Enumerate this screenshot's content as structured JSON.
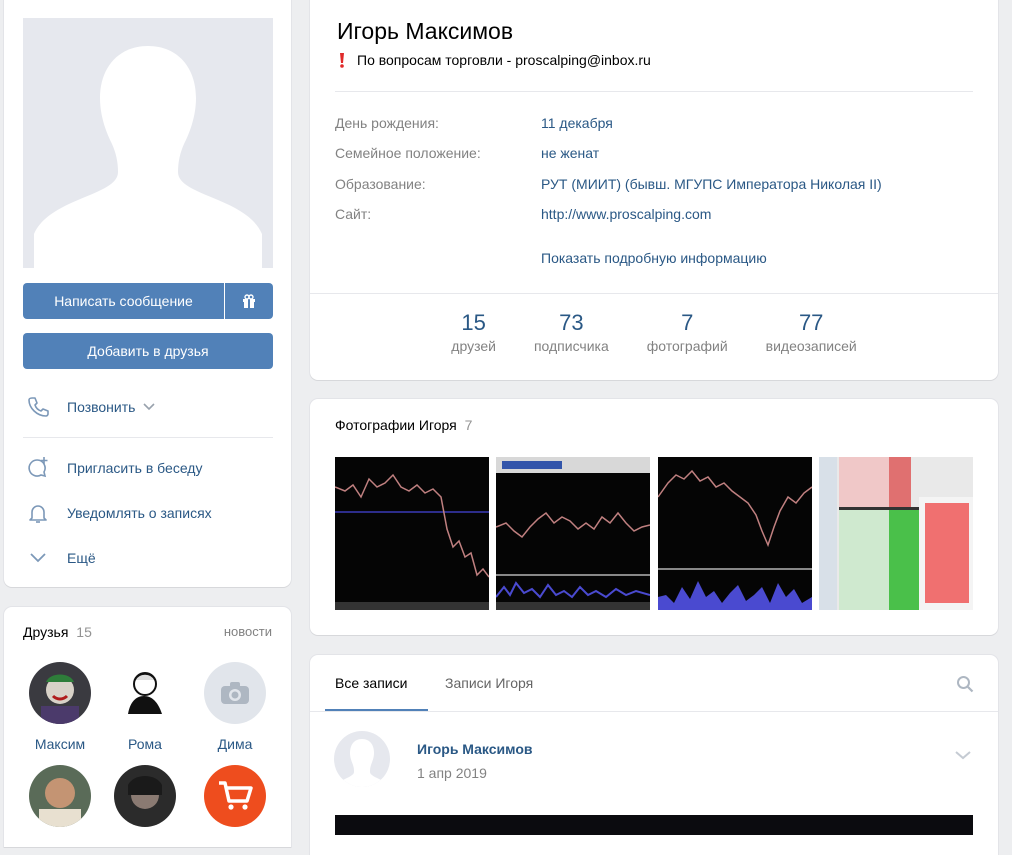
{
  "profile": {
    "name": "Игорь Максимов",
    "status": "По вопросам торговли - proscalping@inbox.ru",
    "info_rows": [
      {
        "key": "День рождения:",
        "value": "11 декабря"
      },
      {
        "key": "Семейное положение:",
        "value": "не женат"
      },
      {
        "key": "Образование:",
        "value": "РУТ (МИИТ) (бывш. МГУПС Императора Николая II)"
      },
      {
        "key": "Сайт:",
        "value": "http://www.proscalping.com"
      }
    ],
    "show_more": "Показать подробную информацию",
    "counters": [
      {
        "num": "15",
        "label": "друзей"
      },
      {
        "num": "73",
        "label": "подписчика"
      },
      {
        "num": "7",
        "label": "фотографий"
      },
      {
        "num": "77",
        "label": "видеозаписей"
      }
    ]
  },
  "sidebar": {
    "message_button": "Написать сообщение",
    "add_friend_button": "Добавить в друзья",
    "call": "Позвонить",
    "invite": "Пригласить в беседу",
    "notify": "Уведомлять о записях",
    "more": "Ещё"
  },
  "friends": {
    "title": "Друзья",
    "count": "15",
    "news_link": "новости",
    "items": [
      {
        "name": "Максим"
      },
      {
        "name": "Рома"
      },
      {
        "name": "Дима"
      }
    ]
  },
  "photos": {
    "title": "Фотографии Игоря",
    "count": "7"
  },
  "wall": {
    "tabs": [
      "Все записи",
      "Записи Игоря"
    ],
    "post_author": "Игорь Максимов",
    "post_date": "1 апр 2019"
  },
  "colors": {
    "accent": "#5181b8",
    "link": "#2a5885",
    "muted": "#828282",
    "background": "#edeef0"
  }
}
